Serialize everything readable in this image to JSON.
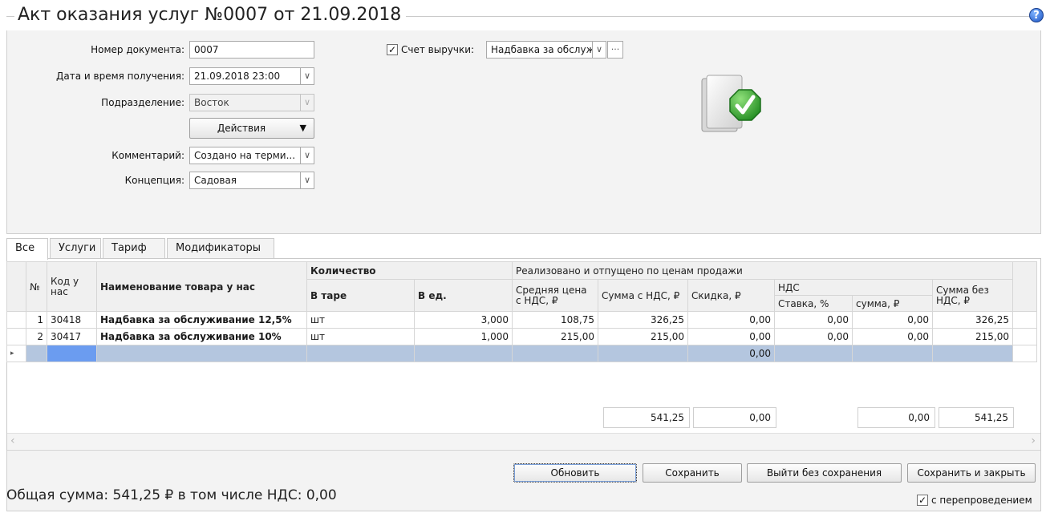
{
  "window": {
    "title": "Акт оказания услуг №0007 от 21.09.2018",
    "help_icon": "?"
  },
  "form": {
    "doc_number_label": "Номер документа:",
    "doc_number_value": "0007",
    "datetime_label": "Дата и время получения:",
    "datetime_value": "21.09.2018 23:00",
    "department_label": "Подразделение:",
    "department_value": "Восток",
    "actions_label": "Действия",
    "comment_label": "Комментарий:",
    "comment_value": "Создано на терми...",
    "concept_label": "Концепция:",
    "concept_value": "Садовая",
    "revenue_account_checked": true,
    "revenue_account_label": "Счет выручки:",
    "revenue_account_value": "Надбавка за обслуж",
    "ellipsis": "···"
  },
  "tabs": [
    {
      "label": "Все",
      "active": true
    },
    {
      "label": "Услуги",
      "active": false
    },
    {
      "label": "Тариф",
      "active": false
    },
    {
      "label": "Модификаторы",
      "active": false
    }
  ],
  "table": {
    "headers": {
      "num": "№",
      "code": "Код у нас",
      "name": "Наименование товара у нас",
      "qty_group": "Количество",
      "qty_tare": "В таре",
      "qty_units": "В ед.",
      "sold_group": "Реализовано и отпущено по ценам продажи",
      "avg_price": "Средняя цена с НДС, ₽",
      "sum_vat": "Сумма с НДС, ₽",
      "discount": "Скидка, ₽",
      "vat_group": "НДС",
      "vat_rate": "Ставка, %",
      "vat_sum": "сумма, ₽",
      "sum_no_vat": "Сумма без НДС, ₽"
    },
    "rows": [
      {
        "num": "1",
        "code": "30418",
        "name": "Надбавка за обслуживание 12,5%",
        "tare": "шт",
        "units": "3,000",
        "avg_price": "108,75",
        "sum_vat": "326,25",
        "discount": "0,00",
        "vat_rate": "0,00",
        "vat_sum": "0,00",
        "sum_no_vat": "326,25"
      },
      {
        "num": "2",
        "code": "30417",
        "name": "Надбавка за обслуживание 10%",
        "tare": "шт",
        "units": "1,000",
        "avg_price": "215,00",
        "sum_vat": "215,00",
        "discount": "0,00",
        "vat_rate": "0,00",
        "vat_sum": "0,00",
        "sum_no_vat": "215,00"
      }
    ],
    "new_row_discount": "0,00",
    "totals": {
      "sum_vat": "541,25",
      "discount": "0,00",
      "vat_sum": "0,00",
      "sum_no_vat": "541,25"
    }
  },
  "footer": {
    "refresh_label": "Обновить",
    "save_label": "Сохранить",
    "exit_label": "Выйти без сохранения",
    "save_close_label": "Сохранить и закрыть",
    "repost_label": "с перепроведением",
    "repost_checked": true,
    "total_text": "Общая сумма: 541,25 ₽ в том числе НДС: 0,00"
  }
}
